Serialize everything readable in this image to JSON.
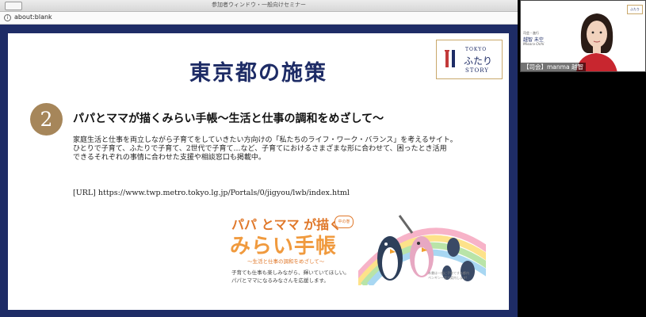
{
  "window": {
    "title": "参加者ウィンドウ・一般向けセミナー",
    "address": "about:blank"
  },
  "slide": {
    "title": "東京都の施策",
    "logo": {
      "line1": "TOKYO",
      "line2": "ふたり",
      "line3": "STORY"
    },
    "number": "2",
    "heading": "パパとママが描くみらい手帳〜生活と仕事の調和をめざして〜",
    "paragraph": [
      "家庭生活と仕事を両立しながら子育てをしていきたい方向けの「私たちのライフ・ワーク・バランス」を考えるサイト。",
      "ひとりで子育て、ふたりで子育て、2世代で子育て…など、子育てにおけるさまざまな形に合わせて、困ったとき活用",
      "できるそれぞれの事情に合わせた支援や相談窓口も掲載中。"
    ],
    "url_line": "[URL] https://www.twp.metro.tokyo.lg.jp/Portals/0/jigyou/lwb/index.html",
    "banner": {
      "main1": "パパ とママ が描く",
      "badge": "中の巻",
      "main2": "みらい手帳",
      "subtitle": "〜生活と仕事の調和をめざして〜",
      "text1": "子育ても仕事も楽しみながら、輝いていてほしい。",
      "text2": "パパとママになるみなさんを応援します。",
      "note1": "本書は一般に子育てする都内",
      "note2": "ペンギンー家が案内します!"
    }
  },
  "camera": {
    "role": "司会・進行",
    "name": "越智 未空",
    "roman": "Misora Ochi",
    "logo_text": "ふたり",
    "nametag": "【司会】manma 越智"
  },
  "colors": {
    "slide_frame": "#1e2c66",
    "title": "#1e2c66",
    "number_circle": "#a6865a",
    "banner_orange": "#e0782a",
    "logo_border": "#c9a86b"
  }
}
